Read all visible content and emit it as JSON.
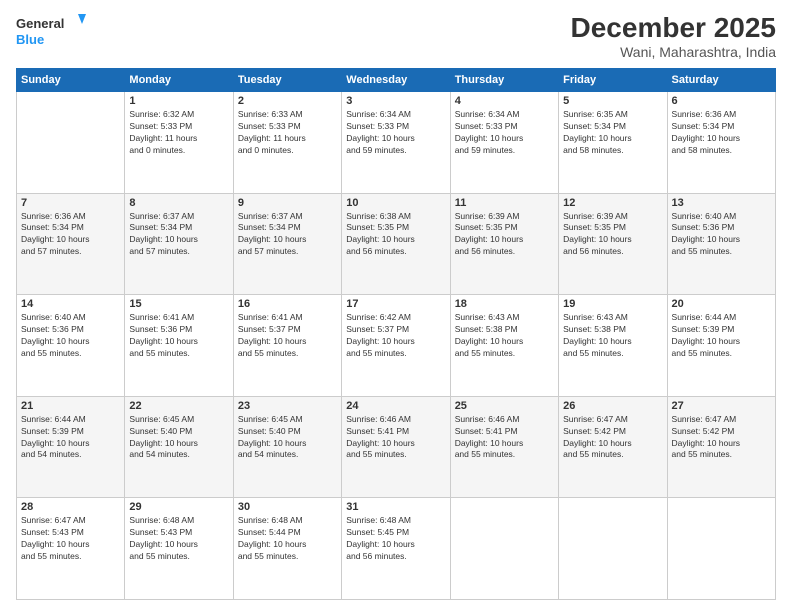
{
  "logo": {
    "line1": "General",
    "line2": "Blue"
  },
  "title": "December 2025",
  "subtitle": "Wani, Maharashtra, India",
  "days_header": [
    "Sunday",
    "Monday",
    "Tuesday",
    "Wednesday",
    "Thursday",
    "Friday",
    "Saturday"
  ],
  "weeks": [
    [
      {
        "day": "",
        "info": ""
      },
      {
        "day": "1",
        "info": "Sunrise: 6:32 AM\nSunset: 5:33 PM\nDaylight: 11 hours\nand 0 minutes."
      },
      {
        "day": "2",
        "info": "Sunrise: 6:33 AM\nSunset: 5:33 PM\nDaylight: 11 hours\nand 0 minutes."
      },
      {
        "day": "3",
        "info": "Sunrise: 6:34 AM\nSunset: 5:33 PM\nDaylight: 10 hours\nand 59 minutes."
      },
      {
        "day": "4",
        "info": "Sunrise: 6:34 AM\nSunset: 5:33 PM\nDaylight: 10 hours\nand 59 minutes."
      },
      {
        "day": "5",
        "info": "Sunrise: 6:35 AM\nSunset: 5:34 PM\nDaylight: 10 hours\nand 58 minutes."
      },
      {
        "day": "6",
        "info": "Sunrise: 6:36 AM\nSunset: 5:34 PM\nDaylight: 10 hours\nand 58 minutes."
      }
    ],
    [
      {
        "day": "7",
        "info": "Sunrise: 6:36 AM\nSunset: 5:34 PM\nDaylight: 10 hours\nand 57 minutes."
      },
      {
        "day": "8",
        "info": "Sunrise: 6:37 AM\nSunset: 5:34 PM\nDaylight: 10 hours\nand 57 minutes."
      },
      {
        "day": "9",
        "info": "Sunrise: 6:37 AM\nSunset: 5:34 PM\nDaylight: 10 hours\nand 57 minutes."
      },
      {
        "day": "10",
        "info": "Sunrise: 6:38 AM\nSunset: 5:35 PM\nDaylight: 10 hours\nand 56 minutes."
      },
      {
        "day": "11",
        "info": "Sunrise: 6:39 AM\nSunset: 5:35 PM\nDaylight: 10 hours\nand 56 minutes."
      },
      {
        "day": "12",
        "info": "Sunrise: 6:39 AM\nSunset: 5:35 PM\nDaylight: 10 hours\nand 56 minutes."
      },
      {
        "day": "13",
        "info": "Sunrise: 6:40 AM\nSunset: 5:36 PM\nDaylight: 10 hours\nand 55 minutes."
      }
    ],
    [
      {
        "day": "14",
        "info": "Sunrise: 6:40 AM\nSunset: 5:36 PM\nDaylight: 10 hours\nand 55 minutes."
      },
      {
        "day": "15",
        "info": "Sunrise: 6:41 AM\nSunset: 5:36 PM\nDaylight: 10 hours\nand 55 minutes."
      },
      {
        "day": "16",
        "info": "Sunrise: 6:41 AM\nSunset: 5:37 PM\nDaylight: 10 hours\nand 55 minutes."
      },
      {
        "day": "17",
        "info": "Sunrise: 6:42 AM\nSunset: 5:37 PM\nDaylight: 10 hours\nand 55 minutes."
      },
      {
        "day": "18",
        "info": "Sunrise: 6:43 AM\nSunset: 5:38 PM\nDaylight: 10 hours\nand 55 minutes."
      },
      {
        "day": "19",
        "info": "Sunrise: 6:43 AM\nSunset: 5:38 PM\nDaylight: 10 hours\nand 55 minutes."
      },
      {
        "day": "20",
        "info": "Sunrise: 6:44 AM\nSunset: 5:39 PM\nDaylight: 10 hours\nand 55 minutes."
      }
    ],
    [
      {
        "day": "21",
        "info": "Sunrise: 6:44 AM\nSunset: 5:39 PM\nDaylight: 10 hours\nand 54 minutes."
      },
      {
        "day": "22",
        "info": "Sunrise: 6:45 AM\nSunset: 5:40 PM\nDaylight: 10 hours\nand 54 minutes."
      },
      {
        "day": "23",
        "info": "Sunrise: 6:45 AM\nSunset: 5:40 PM\nDaylight: 10 hours\nand 54 minutes."
      },
      {
        "day": "24",
        "info": "Sunrise: 6:46 AM\nSunset: 5:41 PM\nDaylight: 10 hours\nand 55 minutes."
      },
      {
        "day": "25",
        "info": "Sunrise: 6:46 AM\nSunset: 5:41 PM\nDaylight: 10 hours\nand 55 minutes."
      },
      {
        "day": "26",
        "info": "Sunrise: 6:47 AM\nSunset: 5:42 PM\nDaylight: 10 hours\nand 55 minutes."
      },
      {
        "day": "27",
        "info": "Sunrise: 6:47 AM\nSunset: 5:42 PM\nDaylight: 10 hours\nand 55 minutes."
      }
    ],
    [
      {
        "day": "28",
        "info": "Sunrise: 6:47 AM\nSunset: 5:43 PM\nDaylight: 10 hours\nand 55 minutes."
      },
      {
        "day": "29",
        "info": "Sunrise: 6:48 AM\nSunset: 5:43 PM\nDaylight: 10 hours\nand 55 minutes."
      },
      {
        "day": "30",
        "info": "Sunrise: 6:48 AM\nSunset: 5:44 PM\nDaylight: 10 hours\nand 55 minutes."
      },
      {
        "day": "31",
        "info": "Sunrise: 6:48 AM\nSunset: 5:45 PM\nDaylight: 10 hours\nand 56 minutes."
      },
      {
        "day": "",
        "info": ""
      },
      {
        "day": "",
        "info": ""
      },
      {
        "day": "",
        "info": ""
      }
    ]
  ]
}
